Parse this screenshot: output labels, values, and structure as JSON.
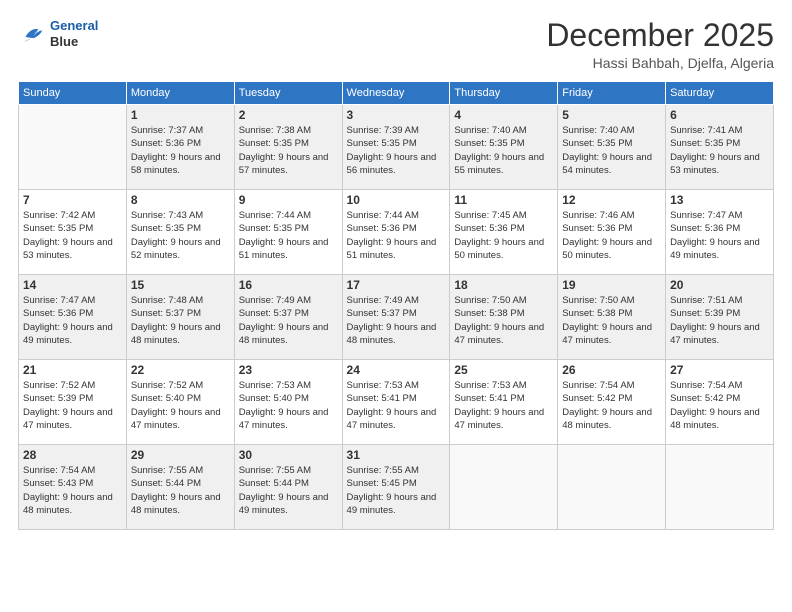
{
  "logo": {
    "line1": "General",
    "line2": "Blue"
  },
  "header": {
    "month": "December 2025",
    "location": "Hassi Bahbah, Djelfa, Algeria"
  },
  "weekdays": [
    "Sunday",
    "Monday",
    "Tuesday",
    "Wednesday",
    "Thursday",
    "Friday",
    "Saturday"
  ],
  "weeks": [
    [
      {
        "day": "",
        "empty": true
      },
      {
        "day": "1",
        "sunrise": "7:37 AM",
        "sunset": "5:36 PM",
        "daylight": "9 hours and 58 minutes."
      },
      {
        "day": "2",
        "sunrise": "7:38 AM",
        "sunset": "5:35 PM",
        "daylight": "9 hours and 57 minutes."
      },
      {
        "day": "3",
        "sunrise": "7:39 AM",
        "sunset": "5:35 PM",
        "daylight": "9 hours and 56 minutes."
      },
      {
        "day": "4",
        "sunrise": "7:40 AM",
        "sunset": "5:35 PM",
        "daylight": "9 hours and 55 minutes."
      },
      {
        "day": "5",
        "sunrise": "7:40 AM",
        "sunset": "5:35 PM",
        "daylight": "9 hours and 54 minutes."
      },
      {
        "day": "6",
        "sunrise": "7:41 AM",
        "sunset": "5:35 PM",
        "daylight": "9 hours and 53 minutes."
      }
    ],
    [
      {
        "day": "7",
        "sunrise": "7:42 AM",
        "sunset": "5:35 PM",
        "daylight": "9 hours and 53 minutes."
      },
      {
        "day": "8",
        "sunrise": "7:43 AM",
        "sunset": "5:35 PM",
        "daylight": "9 hours and 52 minutes."
      },
      {
        "day": "9",
        "sunrise": "7:44 AM",
        "sunset": "5:35 PM",
        "daylight": "9 hours and 51 minutes."
      },
      {
        "day": "10",
        "sunrise": "7:44 AM",
        "sunset": "5:36 PM",
        "daylight": "9 hours and 51 minutes."
      },
      {
        "day": "11",
        "sunrise": "7:45 AM",
        "sunset": "5:36 PM",
        "daylight": "9 hours and 50 minutes."
      },
      {
        "day": "12",
        "sunrise": "7:46 AM",
        "sunset": "5:36 PM",
        "daylight": "9 hours and 50 minutes."
      },
      {
        "day": "13",
        "sunrise": "7:47 AM",
        "sunset": "5:36 PM",
        "daylight": "9 hours and 49 minutes."
      }
    ],
    [
      {
        "day": "14",
        "sunrise": "7:47 AM",
        "sunset": "5:36 PM",
        "daylight": "9 hours and 49 minutes."
      },
      {
        "day": "15",
        "sunrise": "7:48 AM",
        "sunset": "5:37 PM",
        "daylight": "9 hours and 48 minutes."
      },
      {
        "day": "16",
        "sunrise": "7:49 AM",
        "sunset": "5:37 PM",
        "daylight": "9 hours and 48 minutes."
      },
      {
        "day": "17",
        "sunrise": "7:49 AM",
        "sunset": "5:37 PM",
        "daylight": "9 hours and 48 minutes."
      },
      {
        "day": "18",
        "sunrise": "7:50 AM",
        "sunset": "5:38 PM",
        "daylight": "9 hours and 47 minutes."
      },
      {
        "day": "19",
        "sunrise": "7:50 AM",
        "sunset": "5:38 PM",
        "daylight": "9 hours and 47 minutes."
      },
      {
        "day": "20",
        "sunrise": "7:51 AM",
        "sunset": "5:39 PM",
        "daylight": "9 hours and 47 minutes."
      }
    ],
    [
      {
        "day": "21",
        "sunrise": "7:52 AM",
        "sunset": "5:39 PM",
        "daylight": "9 hours and 47 minutes."
      },
      {
        "day": "22",
        "sunrise": "7:52 AM",
        "sunset": "5:40 PM",
        "daylight": "9 hours and 47 minutes."
      },
      {
        "day": "23",
        "sunrise": "7:53 AM",
        "sunset": "5:40 PM",
        "daylight": "9 hours and 47 minutes."
      },
      {
        "day": "24",
        "sunrise": "7:53 AM",
        "sunset": "5:41 PM",
        "daylight": "9 hours and 47 minutes."
      },
      {
        "day": "25",
        "sunrise": "7:53 AM",
        "sunset": "5:41 PM",
        "daylight": "9 hours and 47 minutes."
      },
      {
        "day": "26",
        "sunrise": "7:54 AM",
        "sunset": "5:42 PM",
        "daylight": "9 hours and 48 minutes."
      },
      {
        "day": "27",
        "sunrise": "7:54 AM",
        "sunset": "5:42 PM",
        "daylight": "9 hours and 48 minutes."
      }
    ],
    [
      {
        "day": "28",
        "sunrise": "7:54 AM",
        "sunset": "5:43 PM",
        "daylight": "9 hours and 48 minutes."
      },
      {
        "day": "29",
        "sunrise": "7:55 AM",
        "sunset": "5:44 PM",
        "daylight": "9 hours and 48 minutes."
      },
      {
        "day": "30",
        "sunrise": "7:55 AM",
        "sunset": "5:44 PM",
        "daylight": "9 hours and 49 minutes."
      },
      {
        "day": "31",
        "sunrise": "7:55 AM",
        "sunset": "5:45 PM",
        "daylight": "9 hours and 49 minutes."
      },
      {
        "day": "",
        "empty": true
      },
      {
        "day": "",
        "empty": true
      },
      {
        "day": "",
        "empty": true
      }
    ]
  ]
}
